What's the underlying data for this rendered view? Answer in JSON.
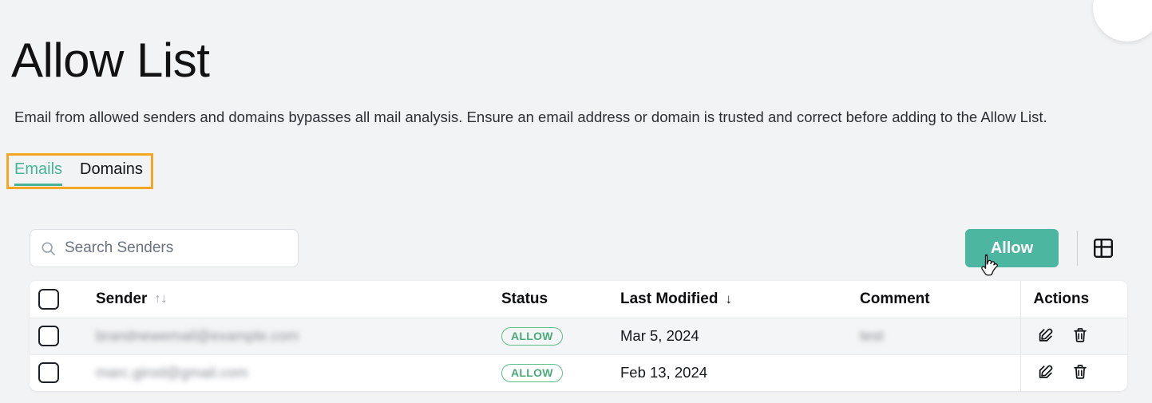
{
  "page": {
    "title": "Allow List",
    "description": "Email from allowed senders and domains bypasses all mail analysis. Ensure an email address or domain is trusted and correct before adding to the Allow List."
  },
  "tabs": [
    {
      "label": "Emails",
      "active": true
    },
    {
      "label": "Domains",
      "active": false
    }
  ],
  "toolbar": {
    "search_placeholder": "Search Senders",
    "search_value": "",
    "search_icon": "search-icon",
    "allow_label": "Allow",
    "grid_icon": "table-layout-icon"
  },
  "table": {
    "columns": [
      {
        "key": "select",
        "label": ""
      },
      {
        "key": "sender",
        "label": "Sender",
        "sort_icon": "↑↓"
      },
      {
        "key": "status",
        "label": "Status"
      },
      {
        "key": "last_modified",
        "label": "Last Modified",
        "sort_icon": "↓"
      },
      {
        "key": "comment",
        "label": "Comment"
      },
      {
        "key": "actions",
        "label": "Actions"
      }
    ],
    "rows": [
      {
        "sender": "brandnewemail@example.com",
        "status": "ALLOW",
        "last_modified": "Mar 5, 2024",
        "comment": "test",
        "actions": [
          "edit-icon",
          "delete-icon"
        ]
      },
      {
        "sender": "marc.girod@gmail.com",
        "status": "ALLOW",
        "last_modified": "Feb 13, 2024",
        "comment": "",
        "actions": [
          "edit-icon",
          "delete-icon"
        ]
      }
    ]
  },
  "colors": {
    "accent_teal": "#4db6a0",
    "tab_active": "#49b397",
    "badge_green": "#4aab78",
    "highlight_orange": "#f5a623",
    "page_background": "#f2f3f5"
  }
}
